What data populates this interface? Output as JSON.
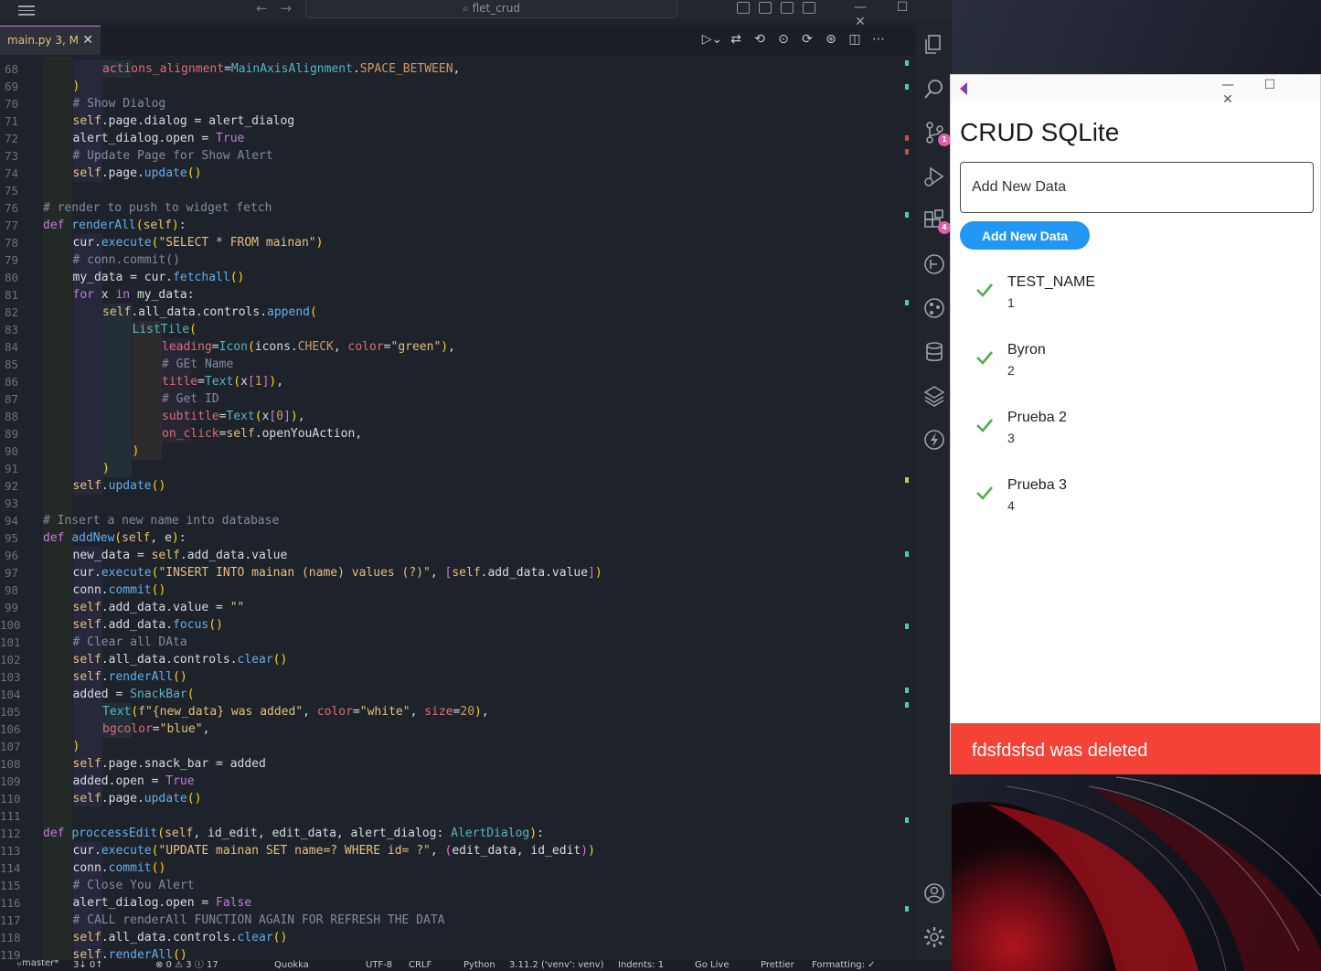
{
  "vscode": {
    "search_text": "flet_crud",
    "tab": {
      "label": "main.py",
      "status": "3, M"
    },
    "status_bar": {
      "branch": "master*",
      "sync": "3↓ 0↑",
      "problems": "⊗ 0 ⚠ 3 ⓘ 17",
      "quokka": "Quokka",
      "encoding": "UTF-8",
      "eol": "CRLF",
      "language": "Python",
      "interpreter": "3.11.2 ('venv': venv)",
      "indent": "Indents: 1",
      "golive": "Go Live",
      "prettier": "Prettier",
      "formatting": "Formatting: ✓"
    },
    "activity_badges": {
      "source_control": "1",
      "extensions": "4"
    },
    "code_lines": [
      {
        "n": "68",
        "i": 3,
        "t": "actions_alignment=MainAxisAlignment.SPACE_BETWEEN,"
      },
      {
        "n": "69",
        "i": 2,
        "t": ")"
      },
      {
        "n": "70",
        "i": 2,
        "t": "# Show Dialog"
      },
      {
        "n": "71",
        "i": 2,
        "t": "self.page.dialog = alert_dialog"
      },
      {
        "n": "72",
        "i": 2,
        "t": "alert_dialog.open = True"
      },
      {
        "n": "73",
        "i": 2,
        "t": "# Update Page for Show Alert"
      },
      {
        "n": "74",
        "i": 2,
        "t": "self.page.update()"
      },
      {
        "n": "75",
        "i": 0,
        "t": ""
      },
      {
        "n": "76",
        "i": 1,
        "t": "# render to push to widget fetch"
      },
      {
        "n": "77",
        "i": 1,
        "t": "def renderAll(self):"
      },
      {
        "n": "78",
        "i": 2,
        "t": "cur.execute(\"SELECT * FROM mainan\")"
      },
      {
        "n": "79",
        "i": 2,
        "t": "# conn.commit()"
      },
      {
        "n": "80",
        "i": 2,
        "t": "my_data = cur.fetchall()"
      },
      {
        "n": "81",
        "i": 2,
        "t": "for x in my_data:"
      },
      {
        "n": "82",
        "i": 3,
        "t": "self.all_data.controls.append("
      },
      {
        "n": "83",
        "i": 4,
        "t": "ListTile("
      },
      {
        "n": "84",
        "i": 5,
        "t": "leading=Icon(icons.CHECK, color=\"green\"),"
      },
      {
        "n": "85",
        "i": 5,
        "t": "# GEt Name"
      },
      {
        "n": "86",
        "i": 5,
        "t": "title=Text(x[1]),"
      },
      {
        "n": "87",
        "i": 5,
        "t": "# Get ID"
      },
      {
        "n": "88",
        "i": 5,
        "t": "subtitle=Text(x[0]),"
      },
      {
        "n": "89",
        "i": 5,
        "t": "on_click=self.openYouAction,"
      },
      {
        "n": "90",
        "i": 4,
        "t": ")"
      },
      {
        "n": "91",
        "i": 3,
        "t": ")"
      },
      {
        "n": "92",
        "i": 2,
        "t": "self.update()"
      },
      {
        "n": "93",
        "i": 0,
        "t": ""
      },
      {
        "n": "94",
        "i": 1,
        "t": "# Insert a new name into database"
      },
      {
        "n": "95",
        "i": 1,
        "t": "def addNew(self, e):"
      },
      {
        "n": "96",
        "i": 2,
        "t": "new_data = self.add_data.value"
      },
      {
        "n": "97",
        "i": 2,
        "t": "cur.execute(\"INSERT INTO mainan (name) values (?)\", [self.add_data.value])"
      },
      {
        "n": "98",
        "i": 2,
        "t": "conn.commit()"
      },
      {
        "n": "99",
        "i": 2,
        "t": "self.add_data.value = \"\""
      },
      {
        "n": "100",
        "i": 2,
        "t": "self.add_data.focus()"
      },
      {
        "n": "101",
        "i": 2,
        "t": "# Clear all DAta"
      },
      {
        "n": "102",
        "i": 2,
        "t": "self.all_data.controls.clear()"
      },
      {
        "n": "103",
        "i": 2,
        "t": "self.renderAll()"
      },
      {
        "n": "104",
        "i": 2,
        "t": "added = SnackBar("
      },
      {
        "n": "105",
        "i": 3,
        "t": "Text(f\"{new_data} was added\", color=\"white\", size=20),"
      },
      {
        "n": "106",
        "i": 3,
        "t": "bgcolor=\"blue\","
      },
      {
        "n": "107",
        "i": 2,
        "t": ")"
      },
      {
        "n": "108",
        "i": 2,
        "t": "self.page.snack_bar = added"
      },
      {
        "n": "109",
        "i": 2,
        "t": "added.open = True"
      },
      {
        "n": "110",
        "i": 2,
        "t": "self.page.update()"
      },
      {
        "n": "111",
        "i": 0,
        "t": ""
      },
      {
        "n": "112",
        "i": 1,
        "t": "def proccessEdit(self, id_edit, edit_data, alert_dialog: AlertDialog):"
      },
      {
        "n": "113",
        "i": 2,
        "t": "cur.execute(\"UPDATE mainan SET name=? WHERE id= ?\", (edit_data, id_edit))"
      },
      {
        "n": "114",
        "i": 2,
        "t": "conn.commit()"
      },
      {
        "n": "115",
        "i": 2,
        "t": "# Close You Alert"
      },
      {
        "n": "116",
        "i": 2,
        "t": "alert_dialog.open = False"
      },
      {
        "n": "117",
        "i": 2,
        "t": "# CALL renderAll FUNCTION AGAIN FOR REFRESH THE DATA"
      },
      {
        "n": "118",
        "i": 2,
        "t": "self.all_data.controls.clear()"
      },
      {
        "n": "119",
        "i": 2,
        "t": "self.renderAll()"
      }
    ]
  },
  "flet_app": {
    "title": "CRUD SQLite",
    "input_placeholder": "Add New Data",
    "button_label": "Add New Data",
    "check_color": "#4caf50",
    "items": [
      {
        "title": "TEST_NAME",
        "subtitle": "1"
      },
      {
        "title": "Byron",
        "subtitle": "2"
      },
      {
        "title": "Prueba 2",
        "subtitle": "3"
      },
      {
        "title": "Prueba 3",
        "subtitle": "4"
      }
    ],
    "snackbar_text": "fdsfdsfsd was deleted",
    "snackbar_color": "#f44336",
    "button_color": "#2196f3"
  }
}
